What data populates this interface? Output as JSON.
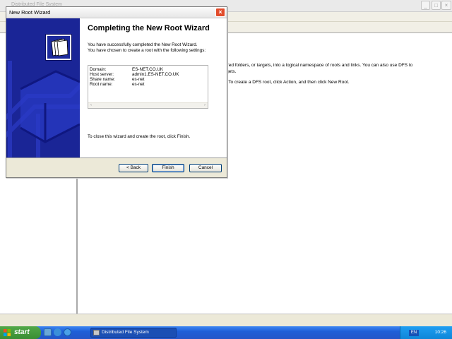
{
  "mmc": {
    "title": "Distributed File System",
    "description_line1": "ared folders, or targets, into a logical namespace of roots and links. You can also use DFS to",
    "description_line2": "rgets.",
    "description_line3": "t. To create a DFS root, click Action, and then click New Root.",
    "controls": {
      "minimize": "_",
      "maximize": "□",
      "close": "×"
    }
  },
  "wizard": {
    "title": "New Root Wizard",
    "close_glyph": "×",
    "heading": "Completing the New Root Wizard",
    "intro_line1": "You have successfully completed the New Root Wizard.",
    "intro_line2": "You have chosen to create a root with the following settings:",
    "summary": [
      {
        "label": "Domain:",
        "value": "ES-NET.CO.UK"
      },
      {
        "label": "Host server:",
        "value": "admin1.ES-NET.CO.UK"
      },
      {
        "label": "Share name:",
        "value": "es-net"
      },
      {
        "label": "Root name:",
        "value": "es-net"
      }
    ],
    "scroll_left": "‹",
    "scroll_right": "›",
    "finish_note": "To close this wizard and create the root, click Finish.",
    "buttons": {
      "back": "< Back",
      "finish": "Finish",
      "cancel": "Cancel"
    }
  },
  "taskbar": {
    "start_label": "start",
    "task_label": "Distributed File System",
    "language": "EN",
    "clock": "10:26"
  },
  "colors": {
    "wizard_banner": "#1a2596",
    "taskbar_blue": "#2356c8",
    "start_green": "#3a8e33",
    "close_red": "#e24c2b"
  }
}
